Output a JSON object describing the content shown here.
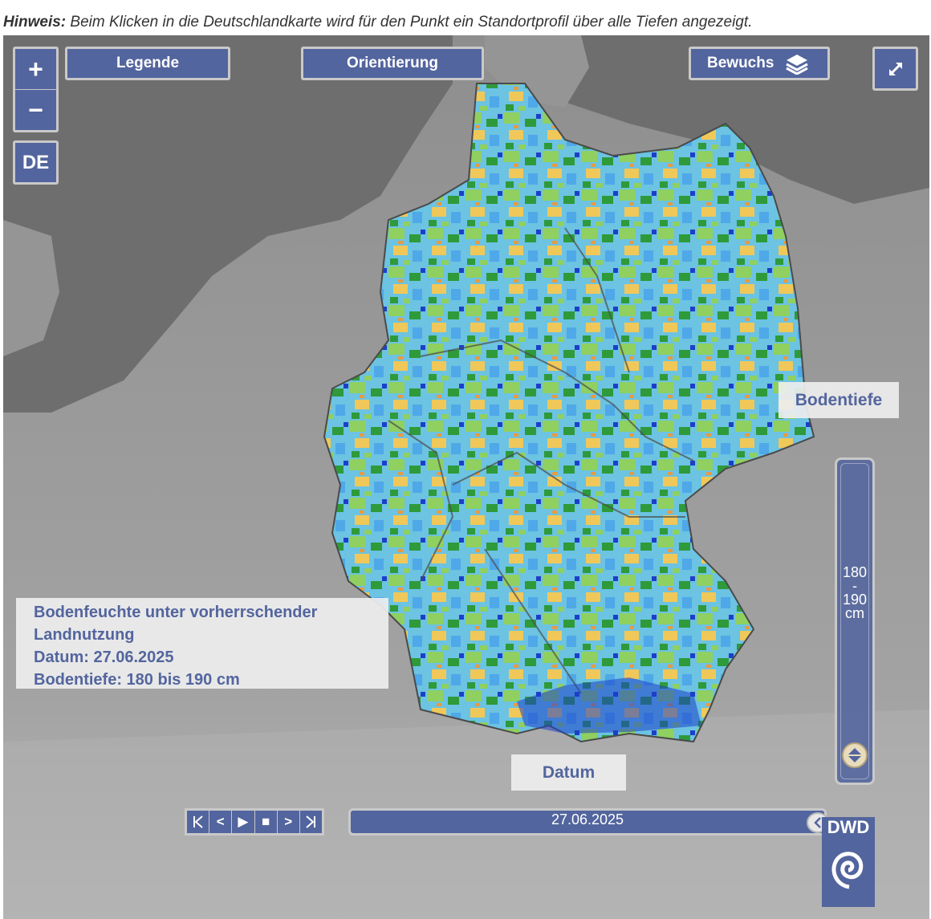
{
  "hint": {
    "label": "Hinweis:",
    "text": " Beim Klicken in die Deutschlandkarte wird für den Punkt ein Standortprofil über alle Tiefen angezeigt."
  },
  "controls": {
    "zoom_in": "+",
    "zoom_out": "−",
    "region": "DE",
    "legend": "Legende",
    "orientation": "Orientierung",
    "vegetation": "Bewuchs",
    "vegetation_icon": "layers-icon",
    "fullscreen_icon": "expand-icon"
  },
  "info": {
    "title_line1": "Bodenfeuchte unter vorherrschender",
    "title_line2": "Landnutzung",
    "date_line": "Datum: 27.06.2025",
    "depth_line": "Bodentiefe: 180 bis 190 cm"
  },
  "depth_slider": {
    "label": "Bodentiefe",
    "from": "180",
    "dash": "-",
    "to": "190",
    "unit": "cm"
  },
  "date_slider": {
    "label": "Datum",
    "value": "27.06.2025"
  },
  "player": {
    "first": "K",
    "prev": "<",
    "play": "▶",
    "stop": "■",
    "next": ">",
    "last": "K"
  },
  "logo": {
    "text": "DWD"
  },
  "colors": {
    "button": "#53659e",
    "button_border": "#c9c9c9",
    "land": "#9a9a9a",
    "sea": "#6e6e6e",
    "moisture_low": "#f0a040",
    "moisture_mid": "#8fd060",
    "moisture_high": "#4fb0e8",
    "moisture_very_high": "#1d3fc8"
  }
}
